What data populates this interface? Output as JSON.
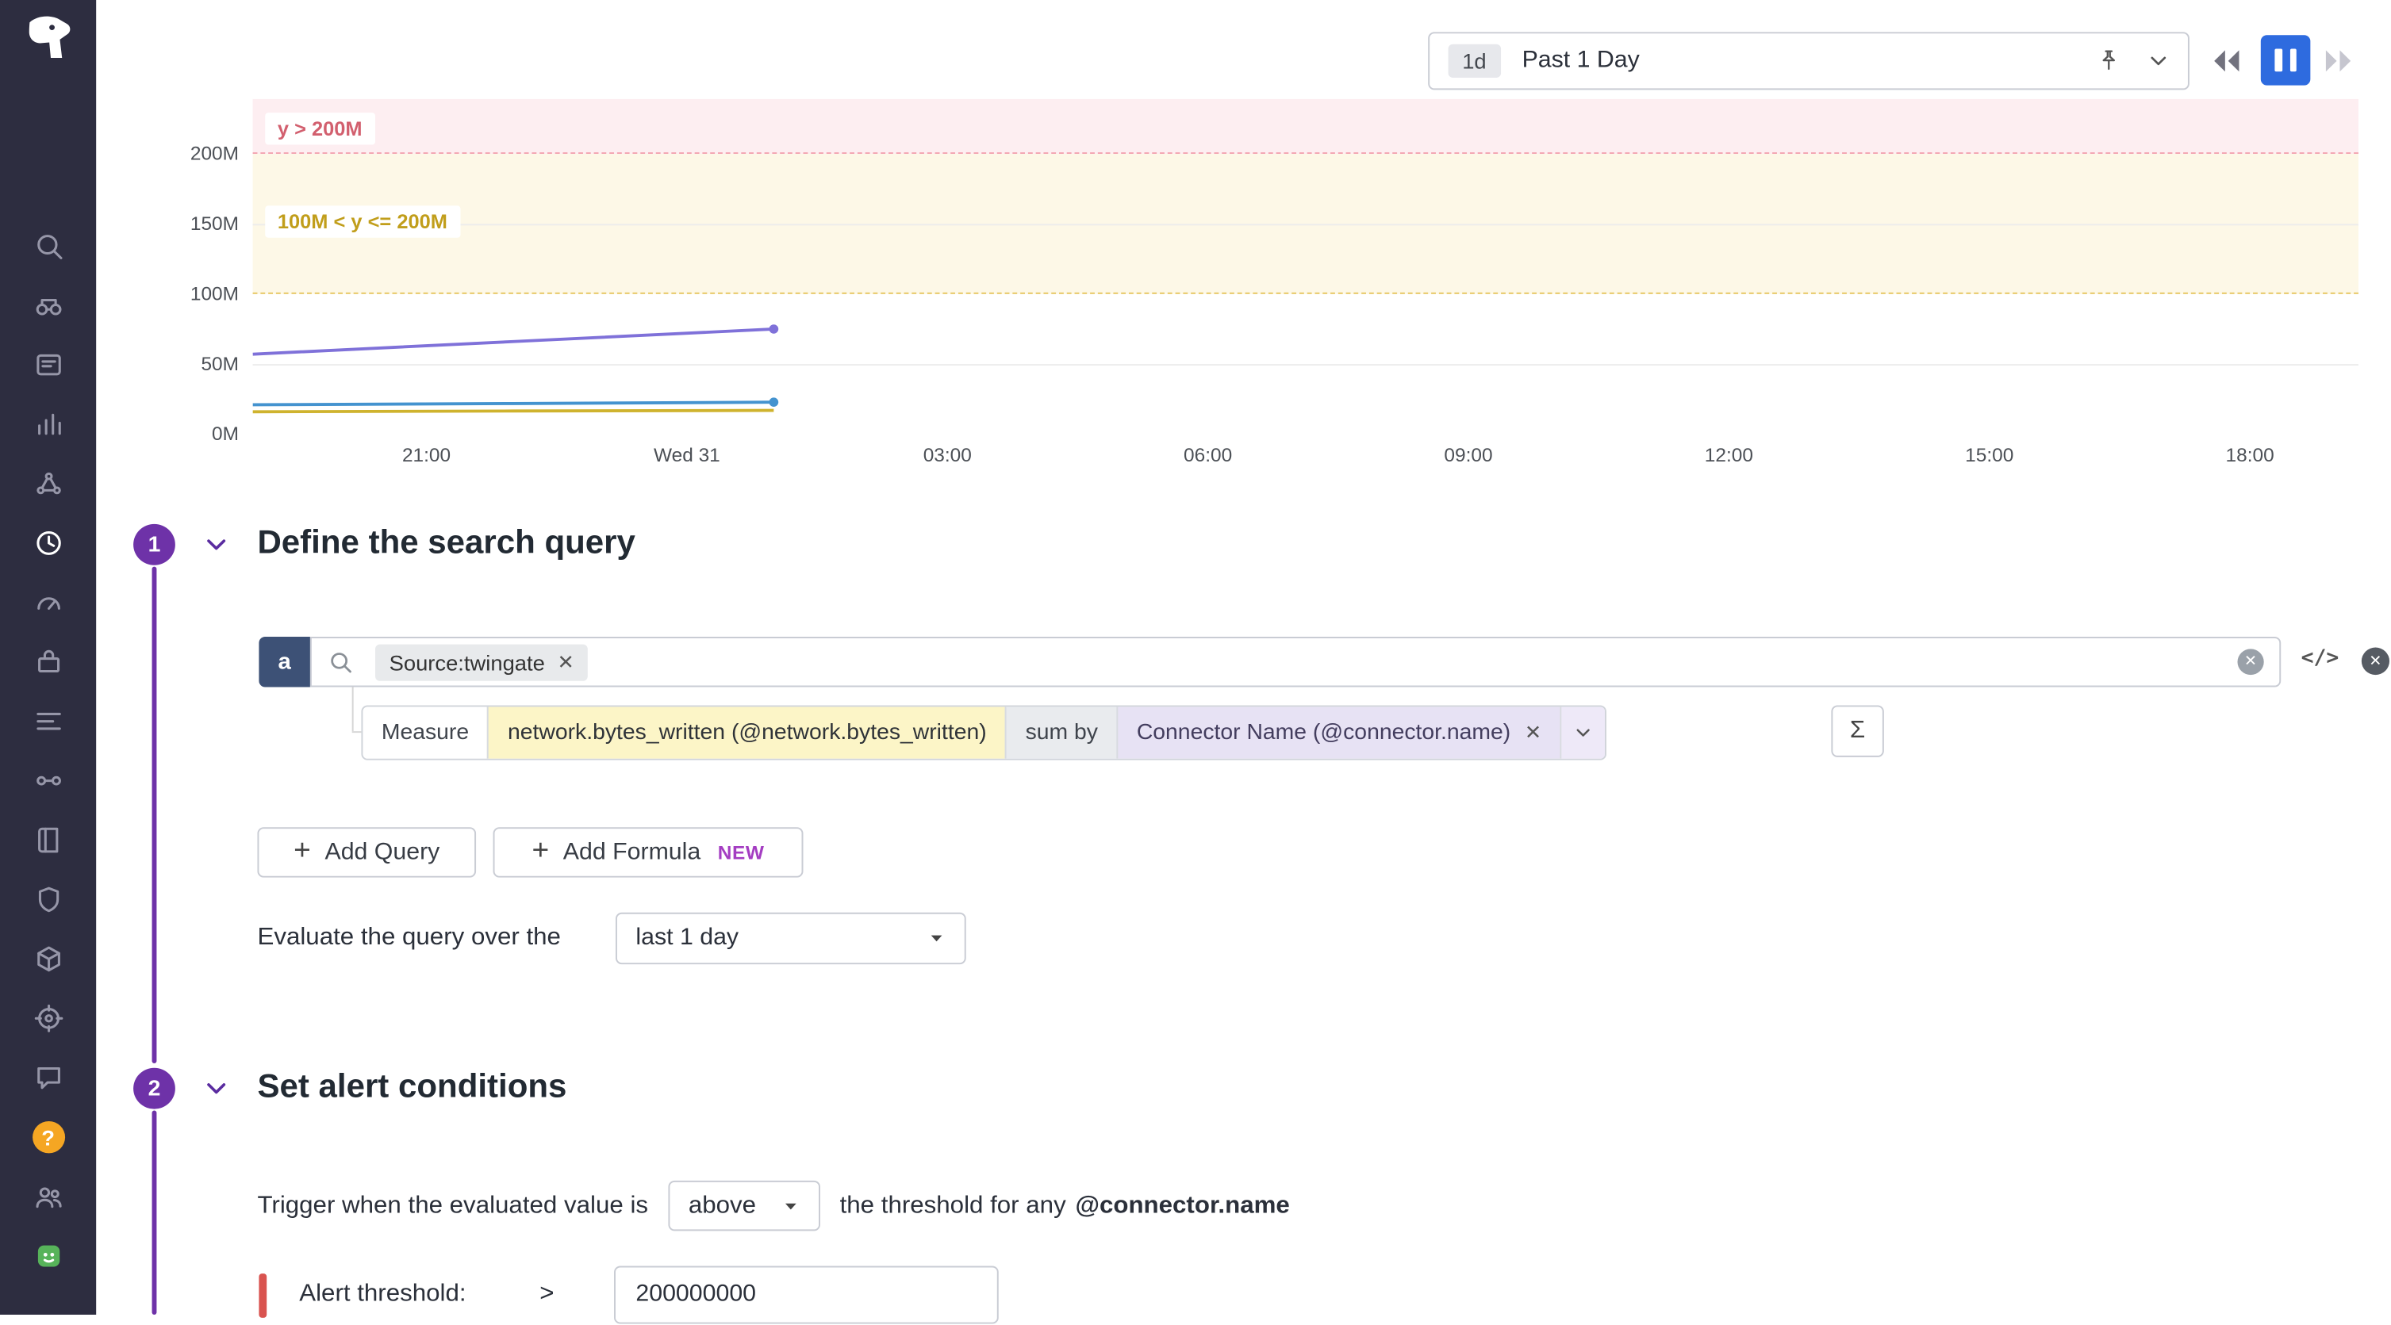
{
  "sidebar": {
    "items": [
      {
        "name": "search"
      },
      {
        "name": "watchdog"
      },
      {
        "name": "events"
      },
      {
        "name": "metrics"
      },
      {
        "name": "apm"
      },
      {
        "name": "monitors",
        "active": true
      },
      {
        "name": "synthetics"
      },
      {
        "name": "integrations"
      },
      {
        "name": "processes"
      },
      {
        "name": "service-map"
      },
      {
        "name": "logs"
      },
      {
        "name": "security"
      },
      {
        "name": "software"
      },
      {
        "name": "ci"
      },
      {
        "name": "feedback"
      },
      {
        "name": "help",
        "glyph": "?"
      },
      {
        "name": "organization"
      },
      {
        "name": "bits-ai"
      }
    ]
  },
  "timebar": {
    "range_badge": "1d",
    "range_label": "Past 1 Day"
  },
  "chart_data": {
    "type": "line",
    "y_max": 239,
    "x_range_hours": 24.25,
    "y_ticks": [
      {
        "v": 200,
        "label": "200M"
      },
      {
        "v": 150,
        "label": "150M"
      },
      {
        "v": 100,
        "label": "100M"
      },
      {
        "v": 50,
        "label": "50M"
      },
      {
        "v": 0,
        "label": "0M"
      }
    ],
    "x_ticks": [
      {
        "h": 2,
        "label": "21:00"
      },
      {
        "h": 5,
        "label": "Wed 31"
      },
      {
        "h": 8,
        "label": "03:00"
      },
      {
        "h": 11,
        "label": "06:00"
      },
      {
        "h": 14,
        "label": "09:00"
      },
      {
        "h": 17,
        "label": "12:00"
      },
      {
        "h": 20,
        "label": "15:00"
      },
      {
        "h": 23,
        "label": "18:00"
      }
    ],
    "gridlines": [
      150,
      50
    ],
    "bands": [
      {
        "label": "y > 200M",
        "from": 200,
        "to": 239,
        "fill": "#fdeef1",
        "edge": "#f2a3b0",
        "text": "#d25f6e",
        "label_at": 216
      },
      {
        "label": "100M < y <= 200M",
        "from": 100,
        "to": 200,
        "fill": "#fdf8e7",
        "edge": "#e6c65f",
        "text": "#c19e1b",
        "label_at": 150
      }
    ],
    "series": [
      {
        "name": "series-purple",
        "color": "#7f71d9",
        "points": [
          [
            0,
            57
          ],
          [
            3,
            66
          ],
          [
            6,
            75
          ]
        ],
        "end_dot": true
      },
      {
        "name": "series-blue",
        "color": "#4493cf",
        "points": [
          [
            0,
            21
          ],
          [
            3,
            21.8
          ],
          [
            6,
            22.8
          ]
        ],
        "end_dot": true
      },
      {
        "name": "series-yellow",
        "color": "#cfb32e",
        "points": [
          [
            0,
            16
          ],
          [
            3,
            16.5
          ],
          [
            6,
            17
          ]
        ],
        "end_dot": false
      }
    ]
  },
  "sections": {
    "define": {
      "number": "1",
      "title": "Define the search query"
    },
    "alert": {
      "number": "2",
      "title": "Set alert conditions"
    }
  },
  "query": {
    "letter": "a",
    "search_token": "Source:twingate",
    "measure_label": "Measure",
    "measure_value": "network.bytes_written (@network.bytes_written)",
    "sum_by": "sum by",
    "group_by": "Connector Name (@connector.name)",
    "code_toggle": "</>",
    "sigma": "Σ",
    "add_query": "Add Query",
    "add_formula": "Add Formula",
    "new_badge": "NEW",
    "evaluate_label": "Evaluate the query over the",
    "evaluate_window": "last 1 day"
  },
  "conditions": {
    "trigger_label": "Trigger when the evaluated value is",
    "comparator": "above",
    "threshold_for": "the threshold for any",
    "group_name": "@connector.name",
    "alert_label": "Alert threshold:",
    "operator": ">",
    "threshold_value": "200000000"
  }
}
